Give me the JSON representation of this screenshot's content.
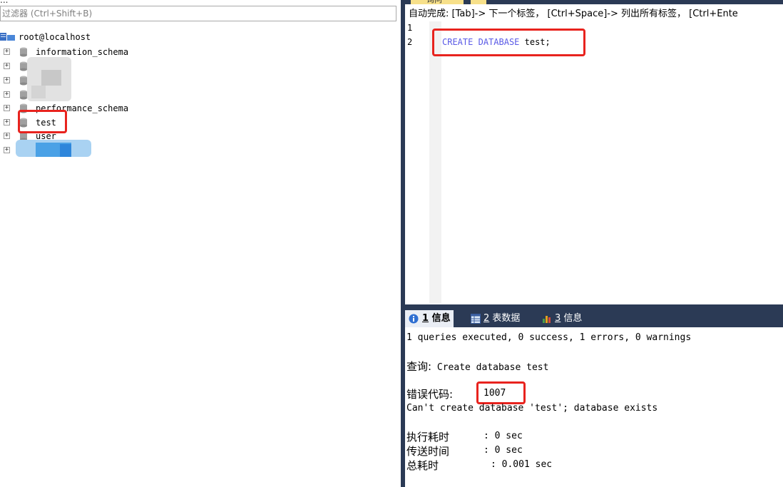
{
  "left_panel": {
    "header_partial": "...",
    "filter_placeholder": "过滤器 (Ctrl+Shift+B)",
    "root": "root@localhost",
    "databases": [
      {
        "name": "information_schema",
        "blurred": false
      },
      {
        "name": "",
        "blurred": true
      },
      {
        "name": "",
        "blurred": true
      },
      {
        "name": "",
        "blurred": true
      },
      {
        "name": "performance_schema",
        "blurred": false
      },
      {
        "name": "test",
        "blurred": false
      },
      {
        "name": "user",
        "blurred": false
      },
      {
        "name": "",
        "blurred": true
      }
    ]
  },
  "editor": {
    "tab_label": "询问",
    "autocomplete_hint": "自动完成: [Tab]-> 下一个标签， [Ctrl+Space]-> 列出所有标签， [Ctrl+Ente",
    "line_numbers": [
      "1",
      "2"
    ],
    "code_keyword1": "CREATE",
    "code_keyword2": "DATABASE",
    "code_rest": "test;"
  },
  "result_tabs": [
    {
      "num": "1",
      "label": "信息",
      "active": true,
      "icon": "info-icon"
    },
    {
      "num": "2",
      "label": "表数据",
      "active": false,
      "icon": "table-icon"
    },
    {
      "num": "3",
      "label": "信息",
      "active": false,
      "icon": "chart-icon"
    }
  ],
  "result": {
    "summary": "1 queries executed, 0 success, 1 errors, 0 warnings",
    "query_label": "查询:",
    "query_text": "Create database test",
    "error_code_label": "错误代码:",
    "error_code": "1007",
    "error_message": "Can't create database 'test'; database exists",
    "exec_time_label": "执行耗时",
    "exec_time": ": 0 sec",
    "transfer_time_label": "传送时间",
    "transfer_time": ": 0 sec",
    "total_time_label": "总耗时",
    "total_time": ": 0.001 sec"
  },
  "colors": {
    "accent_dark": "#2b3a55",
    "highlight_red": "#e8231e",
    "keyword_blue": "#5a5ae6"
  }
}
